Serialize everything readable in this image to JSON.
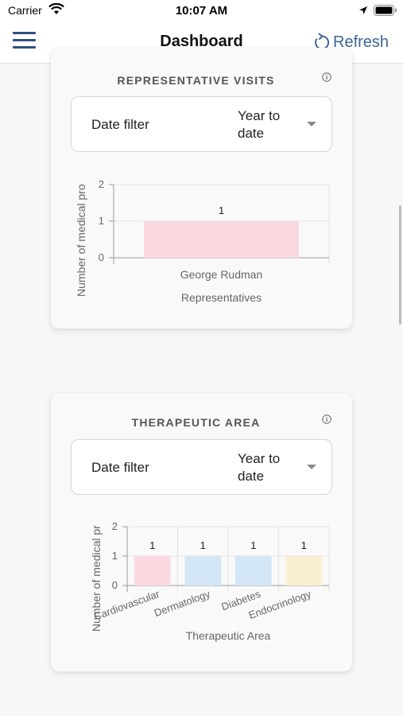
{
  "status_bar": {
    "carrier": "Carrier",
    "time": "10:07 AM"
  },
  "nav": {
    "title": "Dashboard",
    "refresh_label": "Refresh"
  },
  "representative_visits": {
    "title": "REPRESENTATIVE VISITS",
    "filter_label": "Date filter",
    "filter_value": "Year to date"
  },
  "therapeutic_area": {
    "title": "THERAPEUTIC AREA",
    "filter_label": "Date filter",
    "filter_value": "Year to date"
  },
  "colors": {
    "accent": "#3d6594",
    "pink": "#f9d9df",
    "blue": "#d3e6f5",
    "yellow": "#fbefd2"
  },
  "chart_data": [
    {
      "type": "bar",
      "categories": [
        "George Rudman"
      ],
      "values": [
        1
      ],
      "data_labels": [
        "1"
      ],
      "xlabel": "Representatives",
      "ylabel": "Number of medical pro",
      "ylim": [
        0,
        2
      ],
      "yticks": [
        "0",
        "1",
        "2"
      ],
      "bar_colors": [
        "#f9d9df"
      ],
      "grid": true
    },
    {
      "type": "bar",
      "categories": [
        "Cardiovascular",
        "Dermatology",
        "Diabetes",
        "Endocrinology"
      ],
      "values": [
        1,
        1,
        1,
        1
      ],
      "data_labels": [
        "1",
        "1",
        "1",
        "1"
      ],
      "xlabel": "Therapeutic Area",
      "ylabel": "Number of medical pr",
      "ylim": [
        0,
        2
      ],
      "yticks": [
        "0",
        "1",
        "2"
      ],
      "bar_colors": [
        "#f9d9df",
        "#d3e6f5",
        "#d3e6f5",
        "#fbefd2"
      ],
      "grid": true
    }
  ]
}
